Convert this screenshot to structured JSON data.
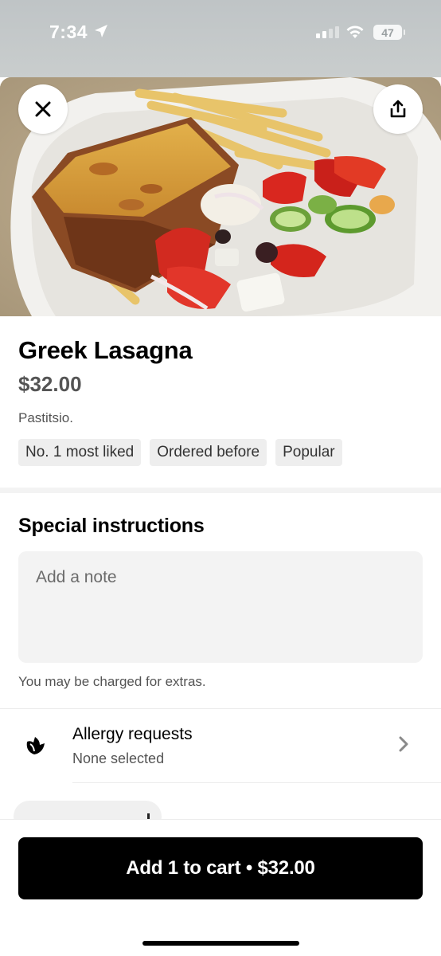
{
  "status_bar": {
    "time": "7:34",
    "battery": "47",
    "icons": [
      "location-arrow-icon",
      "cellular-signal-icon",
      "wifi-icon",
      "battery-icon"
    ]
  },
  "hero": {
    "image": "greek-lasagna-photo",
    "close_icon": "close-icon",
    "share_icon": "share-icon"
  },
  "item": {
    "title": "Greek Lasagna",
    "price": "$32.00",
    "description": "Pastitsio.",
    "tags": [
      "No. 1 most liked",
      "Ordered before",
      "Popular"
    ]
  },
  "special_instructions": {
    "title": "Special instructions",
    "placeholder": "Add a note",
    "note": "You may be charged for extras."
  },
  "allergy": {
    "title": "Allergy requests",
    "subtitle": "None selected",
    "icon": "allergy-icon"
  },
  "cart_button": {
    "label": "Add 1 to cart • $32.00"
  },
  "colors": {
    "primary": "#000000",
    "secondary_text": "#545454",
    "surface": "#f3f3f3"
  }
}
